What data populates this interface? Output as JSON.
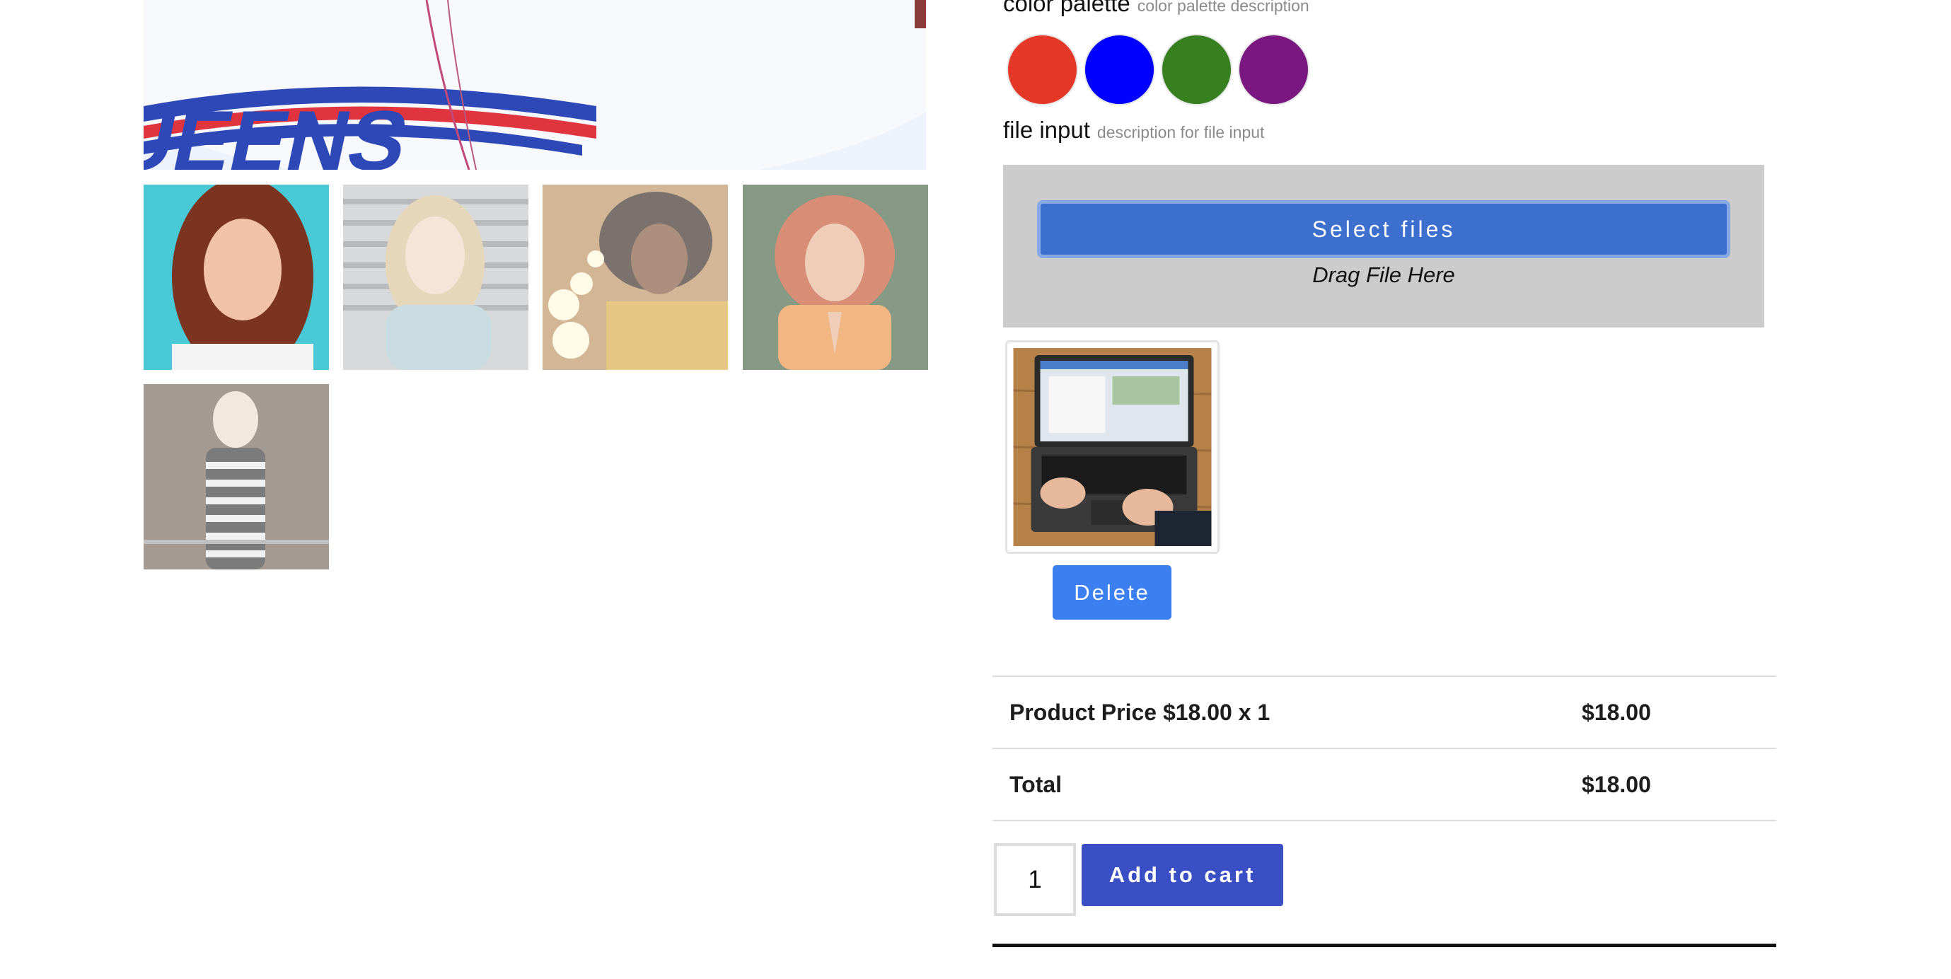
{
  "color_palette": {
    "label": "color palette",
    "description": "color palette description",
    "swatches": [
      {
        "name": "red",
        "color": "#e63828"
      },
      {
        "name": "blue",
        "color": "#0000ff"
      },
      {
        "name": "green",
        "color": "#36801f"
      },
      {
        "name": "purple",
        "color": "#7a1780"
      }
    ]
  },
  "file_input": {
    "label": "file input",
    "description": "description for file input",
    "select_button": "Select files",
    "drag_text": "Drag File Here",
    "delete_button": "Delete"
  },
  "price_table": [
    {
      "label": "Product Price $18.00 x 1",
      "value": "$18.00"
    },
    {
      "label": "Total",
      "value": "$18.00"
    }
  ],
  "quantity": "1",
  "add_to_cart": "Add to cart",
  "gallery": {
    "main_image": "model-shirt-closeup",
    "thumbnails": [
      "woman-red-hair",
      "woman-turtleneck",
      "woman-curly-hair-lights",
      "woman-orange-shirt",
      "woman-striped-dress"
    ]
  }
}
